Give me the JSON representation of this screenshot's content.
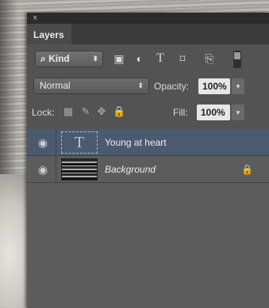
{
  "window": {
    "close_glyph": "×"
  },
  "tabs": [
    {
      "label": "Layers"
    }
  ],
  "filter": {
    "kind_label": "Kind",
    "kind_icon": "search-icon",
    "type_icons": [
      "image-filter-icon",
      "adjustment-filter-icon",
      "type-filter-icon",
      "shape-filter-icon",
      "smart-object-filter-icon"
    ]
  },
  "blending": {
    "mode": "Normal",
    "opacity_label": "Opacity:",
    "opacity_value": "100%"
  },
  "lock": {
    "label": "Lock:",
    "icons": [
      "lock-transparent-icon",
      "lock-image-icon",
      "lock-position-icon",
      "lock-all-icon"
    ],
    "fill_label": "Fill:",
    "fill_value": "100%"
  },
  "layers": [
    {
      "name": "Young at heart",
      "kind": "type",
      "thumb_glyph": "T",
      "selected": true,
      "visible": true,
      "locked": false
    },
    {
      "name": "Background",
      "kind": "image",
      "selected": false,
      "visible": true,
      "locked": true
    }
  ],
  "colors": {
    "panel": "#535353",
    "selected_row": "#4c5a70"
  }
}
